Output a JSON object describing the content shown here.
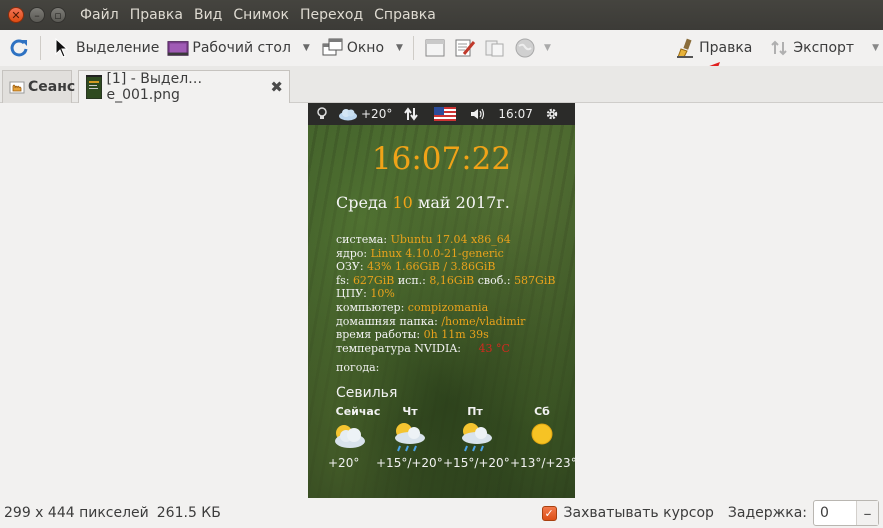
{
  "menubar": {
    "items": [
      "Файл",
      "Правка",
      "Вид",
      "Снимок",
      "Переход",
      "Справка"
    ]
  },
  "toolbar": {
    "selection": "Выделение",
    "desktop": "Рабочий стол",
    "window": "Окно",
    "edit": "Правка",
    "export": "Экспорт"
  },
  "tabs": {
    "session": "Сеанс",
    "file": "[1] - Выдел…e_001.png"
  },
  "screenshot": {
    "panel": {
      "temp": "+20°",
      "time": "16:07"
    },
    "clock": "16:07:22",
    "date": {
      "prefix": "Среда",
      "day": "10",
      "suffix": "май 2017г."
    },
    "info": {
      "system_label": "система:",
      "system_value": "Ubuntu 17.04  x86_64",
      "kernel_label": "ядро:",
      "kernel_value": "Linux 4.10.0-21-generic",
      "ram_label": "ОЗУ:",
      "ram_value": "43% 1.66GiB / 3.86GiB",
      "fs_label": "fs:",
      "fs_value1": "627GiB",
      "fs_used_label": "исп.:",
      "fs_value2": "8,16GiB",
      "fs_free_label": "своб.:",
      "fs_value3": "587GiB",
      "cpu_label": "ЦПУ:",
      "cpu_value": "10%",
      "computer_label": "компьютер:",
      "computer_value": "compizomania",
      "home_label": "домашняя папка:",
      "home_value": "/home/vladimir",
      "uptime_label": "время работы:",
      "uptime_value": "0h 11m 39s",
      "nvidia_label": "температура NVIDIA:",
      "nvidia_value": "43  °C",
      "weather_label": "погода:"
    },
    "city": "Севилья",
    "forecast": [
      {
        "day": "Сейчас",
        "temp": "+20°"
      },
      {
        "day": "Чт",
        "temp": "+15°/+20°"
      },
      {
        "day": "Пт",
        "temp": "+15°/+20°"
      },
      {
        "day": "Сб",
        "temp": "+13°/+23°"
      }
    ]
  },
  "statusbar": {
    "dimensions": "299 x 444 пикселей",
    "size": "261.5 КБ",
    "capture_cursor": "Захватывать курсор",
    "delay_label": "Задержка:",
    "delay_value": "0"
  },
  "colors": {
    "accent_orange": "#f0a318",
    "annotation_arrow": "#e02020"
  }
}
